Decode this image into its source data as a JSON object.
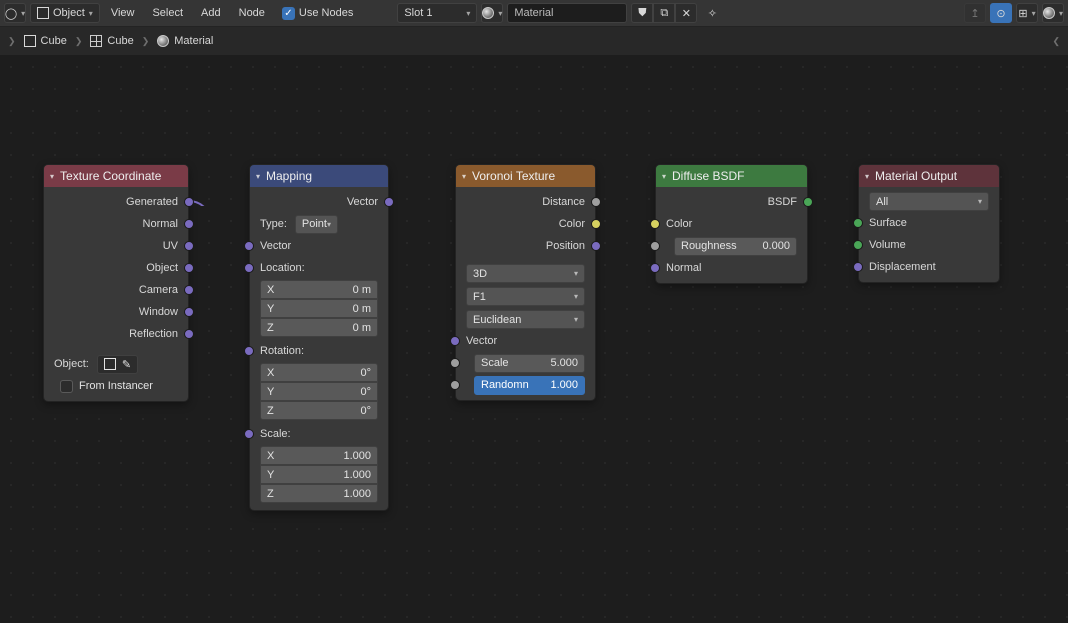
{
  "header": {
    "editor_type": "Shader Editor",
    "object_mode": "Object",
    "menus": [
      "View",
      "Select",
      "Add",
      "Node"
    ],
    "use_nodes_label": "Use Nodes",
    "use_nodes_checked": true,
    "slot_label": "Slot 1",
    "material_name": "Material",
    "right_icons": [
      "arrow-up-icon",
      "overlays-icon",
      "snap-icon",
      "shading-icon"
    ]
  },
  "breadcrumb": [
    {
      "icon": "mesh-icon",
      "label": "Cube"
    },
    {
      "icon": "modifier-icon",
      "label": "Cube"
    },
    {
      "icon": "material-icon",
      "label": "Material"
    }
  ],
  "nodes": {
    "texcoord": {
      "title": "Texture Coordinate",
      "outputs": [
        "Generated",
        "Normal",
        "UV",
        "Object",
        "Camera",
        "Window",
        "Reflection"
      ],
      "object_label": "Object:",
      "from_instancer": "From Instancer"
    },
    "mapping": {
      "title": "Mapping",
      "out": "Vector",
      "type_label": "Type:",
      "type_value": "Point",
      "in_vector": "Vector",
      "loc_label": "Location:",
      "loc": {
        "x_l": "X",
        "x_v": "0 m",
        "y_l": "Y",
        "y_v": "0 m",
        "z_l": "Z",
        "z_v": "0 m"
      },
      "rot_label": "Rotation:",
      "rot": {
        "x_l": "X",
        "x_v": "0°",
        "y_l": "Y",
        "y_v": "0°",
        "z_l": "Z",
        "z_v": "0°"
      },
      "scl_label": "Scale:",
      "scl": {
        "x_l": "X",
        "x_v": "1.000",
        "y_l": "Y",
        "y_v": "1.000",
        "z_l": "Z",
        "z_v": "1.000"
      }
    },
    "voronoi": {
      "title": "Voronoi Texture",
      "out_distance": "Distance",
      "out_color": "Color",
      "out_position": "Position",
      "dim": "3D",
      "feature": "F1",
      "metric": "Euclidean",
      "in_vector": "Vector",
      "scale_l": "Scale",
      "scale_v": "5.000",
      "random_l": "Randomn",
      "random_v": "1.000"
    },
    "diffuse": {
      "title": "Diffuse BSDF",
      "out": "BSDF",
      "in_color": "Color",
      "rough_l": "Roughness",
      "rough_v": "0.000",
      "in_normal": "Normal"
    },
    "output": {
      "title": "Material Output",
      "target": "All",
      "in_surface": "Surface",
      "in_volume": "Volume",
      "in_disp": "Displacement"
    }
  }
}
